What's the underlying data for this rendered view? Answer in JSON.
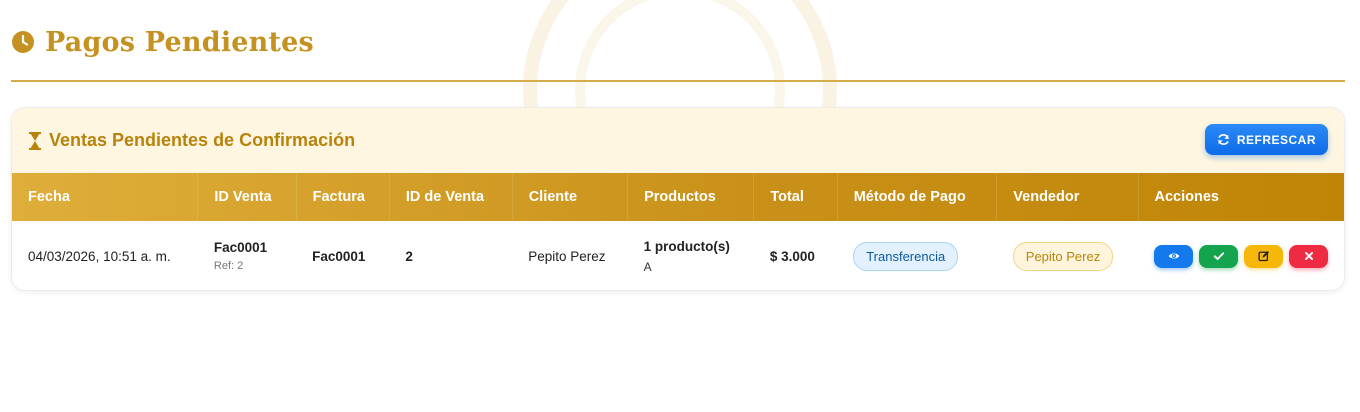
{
  "page": {
    "title": "Pagos Pendientes",
    "accent": "#c59221",
    "icon": "clock-icon"
  },
  "card": {
    "title": "Ventas Pendientes de Confirmación",
    "icon": "hourglass-icon",
    "refresh_label": "REFRESCAR",
    "refresh_icon": "refresh-icon"
  },
  "table": {
    "columns": [
      "Fecha",
      "ID Venta",
      "Factura",
      "ID de Venta",
      "Cliente",
      "Productos",
      "Total",
      "Método de Pago",
      "Vendedor",
      "Acciones"
    ],
    "rows": [
      {
        "fecha": "04/03/2026, 10:51 a. m.",
        "id_venta": "Fac0001",
        "ref": "Ref: 2",
        "factura": "Fac0001",
        "id_de_venta": "2",
        "cliente": "Pepito Perez",
        "productos": "1 producto(s)",
        "productos_detalle": "A",
        "total": "$ 3.000",
        "metodo_pago": "Transferencia",
        "vendedor": "Pepito Perez",
        "actions": [
          "eye-icon",
          "check-icon",
          "edit-icon",
          "close-icon"
        ]
      }
    ]
  },
  "colors": {
    "header_gradient_start": "#dfae3a",
    "header_gradient_end": "#c08506",
    "card_header_bg": "#fef6e0",
    "primary_blue": "#1479ec",
    "success_green": "#14a44d",
    "warning_yellow": "#f6b709",
    "danger_red": "#ef2b43"
  }
}
